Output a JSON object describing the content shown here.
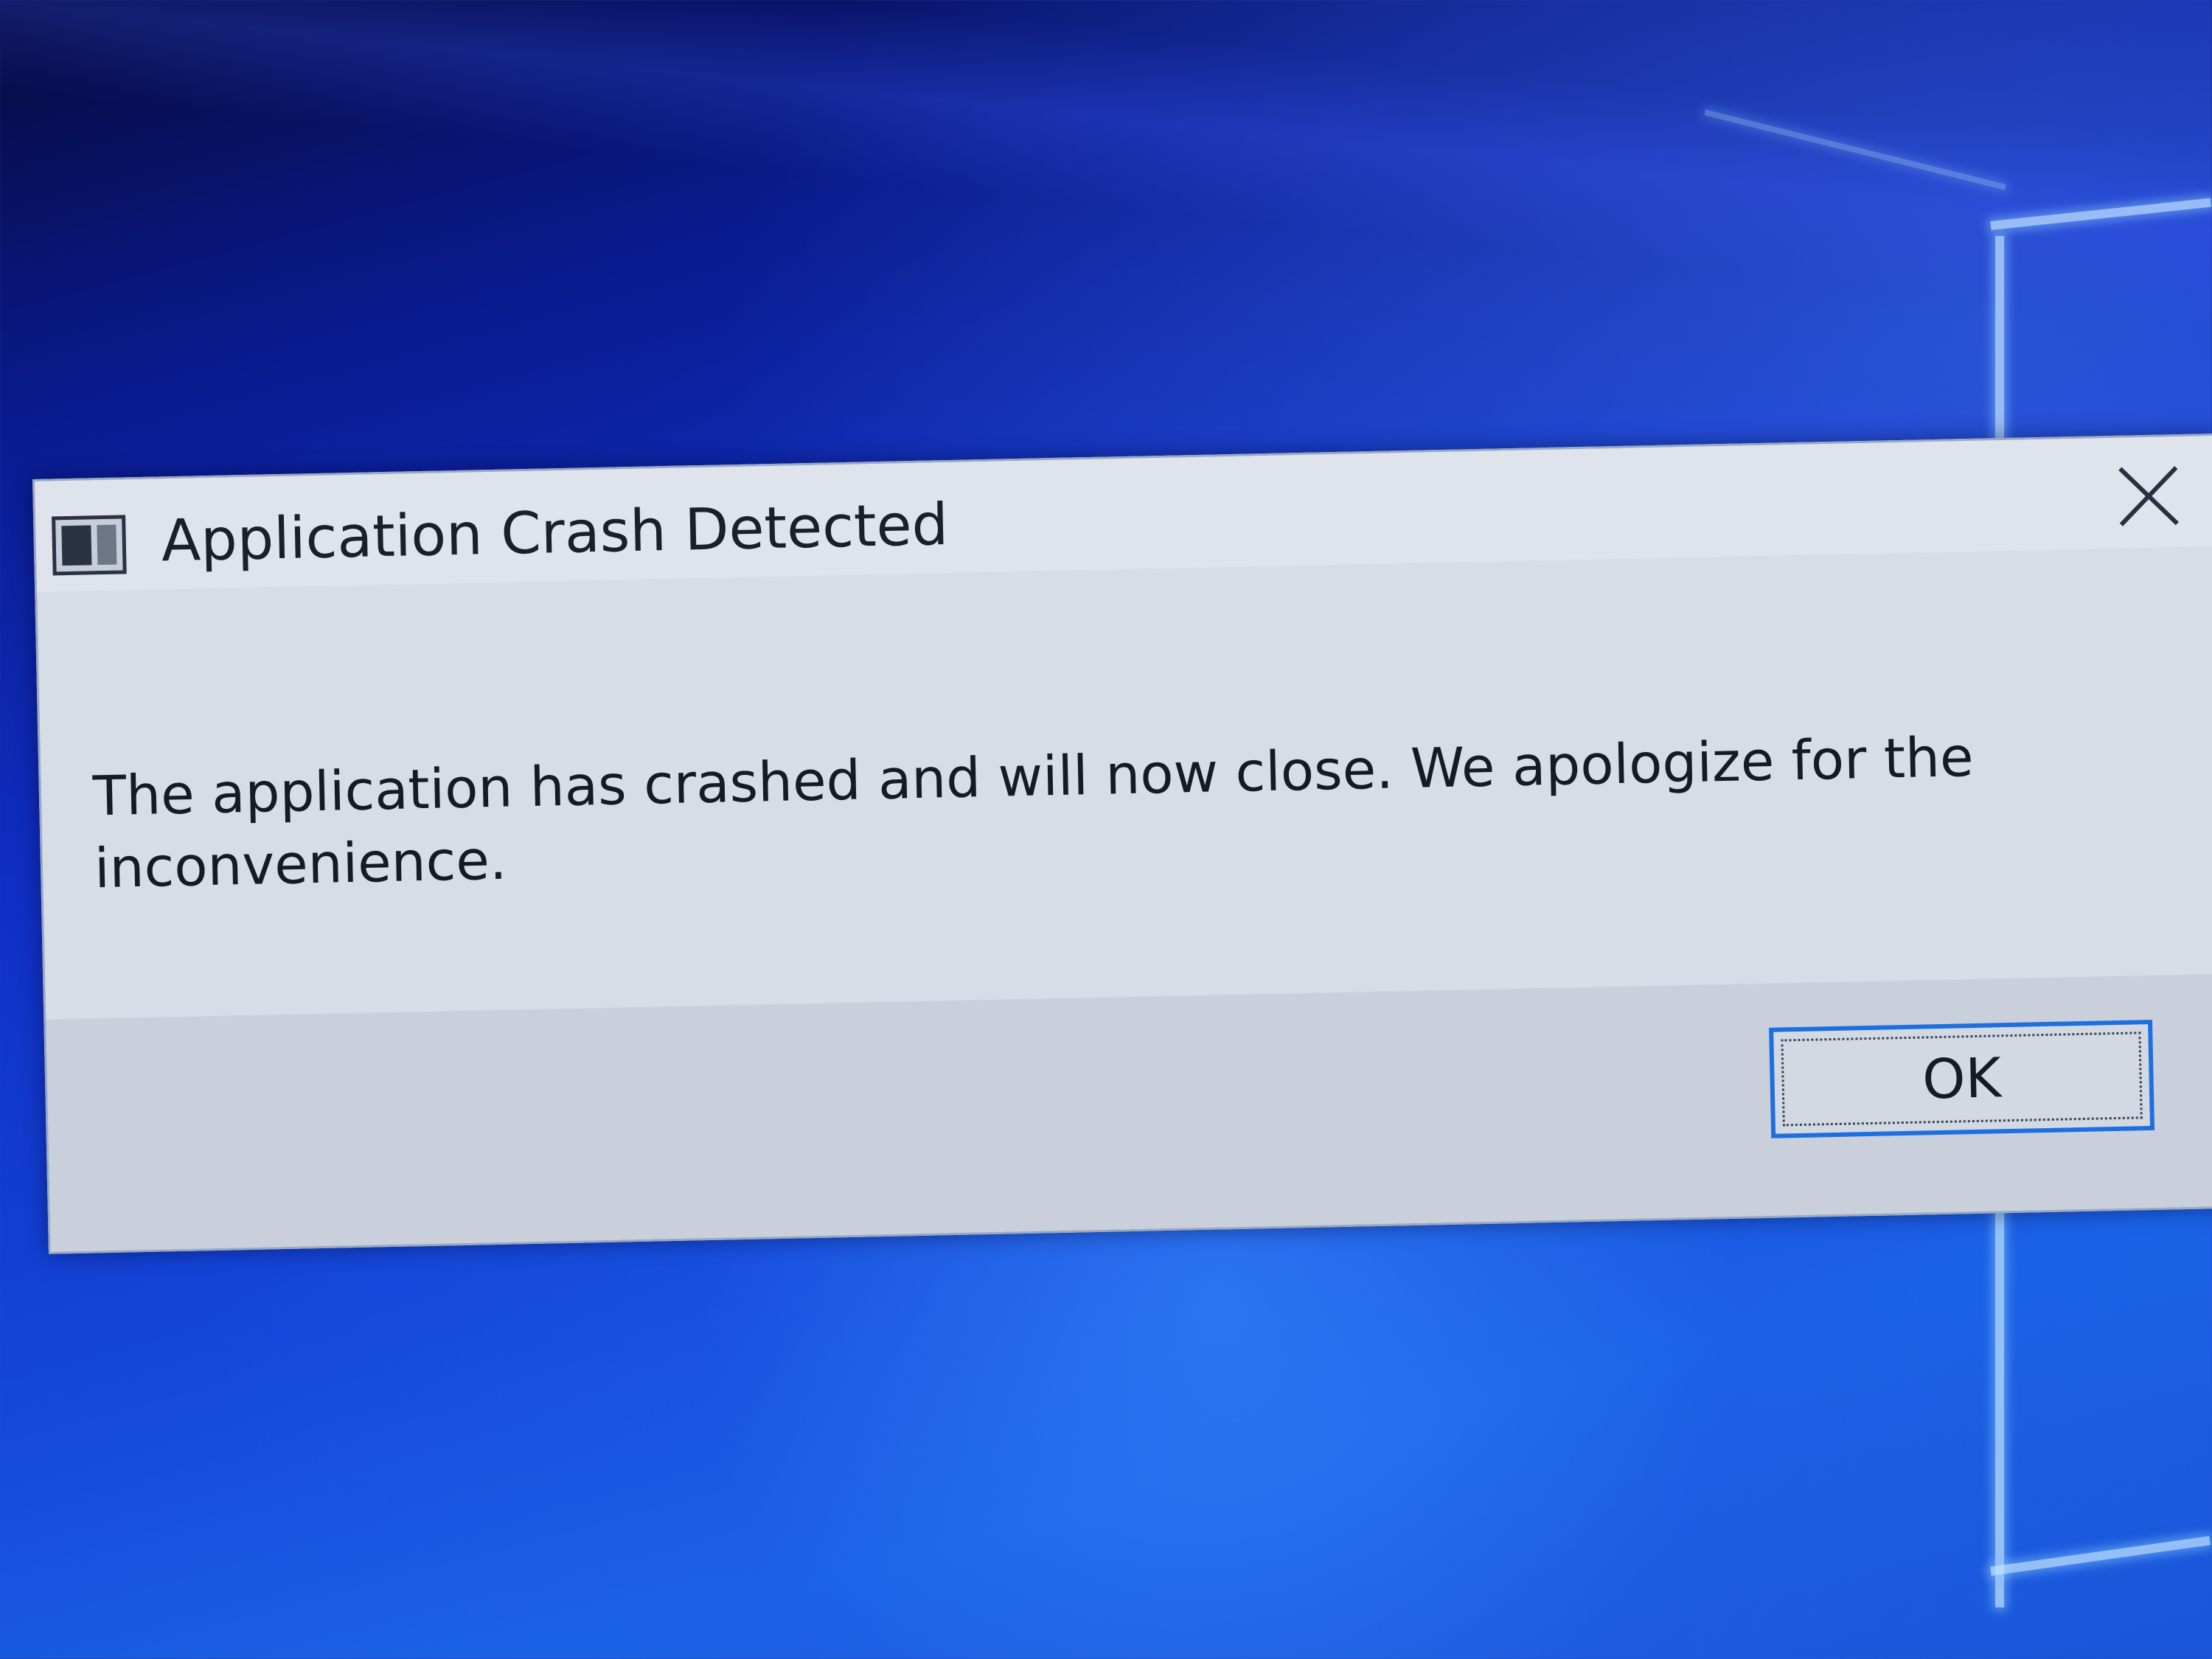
{
  "dialog": {
    "title": "Application Crash Detected",
    "message": "The application has crashed and will now close. We apologize for the inconvenience.",
    "ok_label": "OK",
    "app_icon": "application-window-icon",
    "close_icon": "close-icon"
  },
  "colors": {
    "desktop_blue": "#1446d8",
    "dialog_bg": "#d7dde6",
    "footer_bg": "#c9d0db",
    "focus_accent": "#1f6fe0"
  }
}
